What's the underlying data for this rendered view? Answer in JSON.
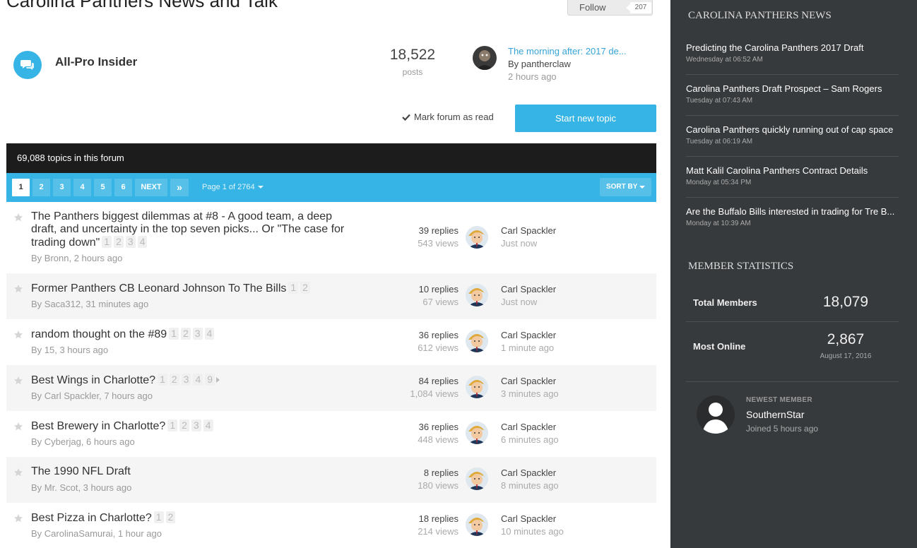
{
  "forum": {
    "title": "Carolina Panthers News and Talk",
    "follow_label": "Follow",
    "follow_count": "207",
    "name": "All-Pro Insider",
    "posts_count": "18,522",
    "posts_label": "posts",
    "last_post": {
      "title": "The morning after: 2017 de...",
      "by": "By pantherclaw",
      "time": "2 hours ago"
    },
    "mark_read": "Mark forum as read",
    "start_topic": "Start new topic",
    "topics_count": "69,088 topics in this forum"
  },
  "pagination": {
    "pages": [
      "1",
      "2",
      "3",
      "4",
      "5",
      "6"
    ],
    "next": "NEXT",
    "last_glyph": "»",
    "page_of": "Page 1 of 2764",
    "sort_by": "SORT BY"
  },
  "topics": [
    {
      "title": "The Panthers biggest dilemmas at #8 - A good team, a deep draft, and uncertainty in the top seven picks... Or \"The case for trading down\"",
      "pages": [
        "1",
        "2",
        "3",
        "4"
      ],
      "by": "By Bronn, 2 hours ago",
      "replies": "39 replies",
      "views": "543 views",
      "last_user": "Carl Spackler",
      "last_time": "Just now"
    },
    {
      "title": "Former Panthers CB Leonard Johnson To The Bills",
      "pages": [
        "1",
        "2"
      ],
      "by": "By Saca312, 31 minutes ago",
      "replies": "10 replies",
      "views": "67 views",
      "last_user": "Carl Spackler",
      "last_time": "Just now"
    },
    {
      "title": "random thought on the #89",
      "pages": [
        "1",
        "2",
        "3",
        "4"
      ],
      "by": "By 15, 3 hours ago",
      "replies": "36 replies",
      "views": "612 views",
      "last_user": "Carl Spackler",
      "last_time": "1 minute ago"
    },
    {
      "title": "Best Wings in Charlotte?",
      "pages": [
        "1",
        "2",
        "3",
        "4",
        "9"
      ],
      "by": "By Carl Spackler, 7 hours ago",
      "replies": "84 replies",
      "views": "1,084 views",
      "last_user": "Carl Spackler",
      "last_time": "3 minutes ago"
    },
    {
      "title": "Best Brewery in Charlotte?",
      "pages": [
        "1",
        "2",
        "3",
        "4"
      ],
      "by": "By Cyberjag, 6 hours ago",
      "replies": "36 replies",
      "views": "448 views",
      "last_user": "Carl Spackler",
      "last_time": "6 minutes ago"
    },
    {
      "title": "The 1990 NFL Draft",
      "pages": [],
      "by": "By Mr. Scot, 3 hours ago",
      "replies": "8 replies",
      "views": "180 views",
      "last_user": "Carl Spackler",
      "last_time": "8 minutes ago"
    },
    {
      "title": "Best Pizza in Charlotte?",
      "pages": [
        "1",
        "2"
      ],
      "by": "By CarolinaSamurai, 1 hour ago",
      "replies": "18 replies",
      "views": "214 views",
      "last_user": "Carl Spackler",
      "last_time": "10 minutes ago"
    }
  ],
  "sidebar": {
    "news_heading": "CAROLINA PANTHERS NEWS",
    "news": [
      {
        "title": "Predicting the Carolina Panthers 2017 Draft",
        "date": "Wednesday at 06:52 AM"
      },
      {
        "title": "Carolina Panthers Draft Prospect – Sam Rogers",
        "date": "Tuesday at 07:43 AM"
      },
      {
        "title": "Carolina Panthers quickly running out of cap space",
        "date": "Tuesday at 06:19 AM"
      },
      {
        "title": "Matt Kalil Carolina Panthers Contract Details",
        "date": "Monday at 05:34 PM"
      },
      {
        "title": "Are the Buffalo Bills interested in trading for Tre B...",
        "date": "Monday at 10:39 AM"
      }
    ],
    "stats_heading": "MEMBER STATISTICS",
    "total_members_label": "Total Members",
    "total_members": "18,079",
    "most_online_label": "Most Online",
    "most_online": "2,867",
    "most_online_date": "August 17, 2016",
    "newest_label": "NEWEST MEMBER",
    "newest_name": "SouthernStar",
    "newest_joined": "Joined 5 hours ago"
  },
  "colors": {
    "accent": "#36b4e5",
    "dark_bar": "#1c1c1c",
    "sidebar_bg": "#373a3c",
    "link": "#36a3d8"
  }
}
